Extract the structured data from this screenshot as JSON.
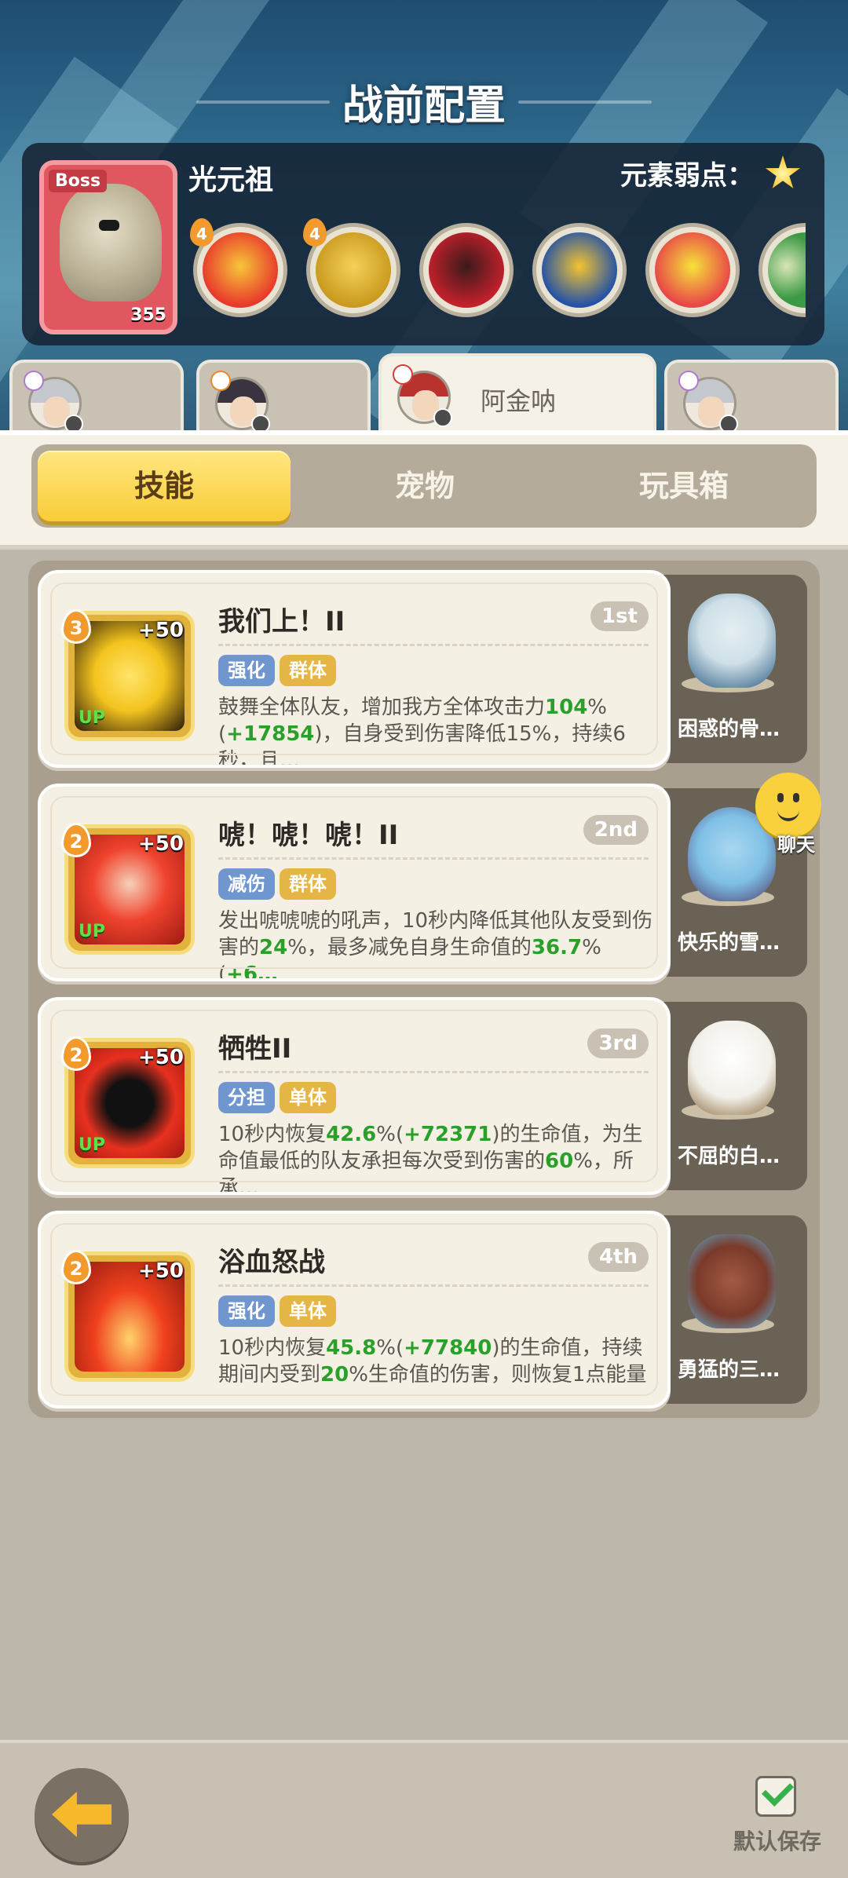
{
  "header": {
    "title": "战前配置"
  },
  "boss": {
    "badge": "Boss",
    "level": "355",
    "name": "光元祖",
    "weakness_label": "元素弱点：",
    "weakness_icon": "light-star-icon",
    "skills": [
      {
        "icon": "punch-fist-icon",
        "level": "4",
        "colors": [
          "#e8392b",
          "#f7c63a"
        ]
      },
      {
        "icon": "gold-burst-icon",
        "level": "4",
        "colors": [
          "#c99a1e",
          "#f5d15a"
        ]
      },
      {
        "icon": "red-dragon-icon",
        "level": "",
        "colors": [
          "#c3202c",
          "#3b1a1a"
        ]
      },
      {
        "icon": "yellow-bird-icon",
        "level": "",
        "colors": [
          "#2452a6",
          "#f4c430"
        ]
      },
      {
        "icon": "red-shoe-icon",
        "level": "",
        "colors": [
          "#e84747",
          "#f6e33a"
        ]
      },
      {
        "icon": "green-partial-icon",
        "level": "",
        "colors": [
          "#3d9a44",
          "#d8e6b8"
        ]
      }
    ]
  },
  "heroes": [
    {
      "name": "",
      "avatar": "silver-hair-hero-avatar",
      "hair": "#c4c7cc",
      "mini": "#b07ad0"
    },
    {
      "name": "",
      "avatar": "dark-hair-hero-avatar",
      "hair": "#3a3440",
      "mini": "#e28b2a"
    },
    {
      "name": "阿金呐",
      "avatar": "red-hair-hero-avatar",
      "hair": "#b8322e",
      "mini": "#d93a3a",
      "active": true
    },
    {
      "name": "",
      "avatar": "silver-hair-hero-avatar-2",
      "hair": "#c4c7cc",
      "mini": "#b07ad0"
    }
  ],
  "tabs": {
    "skills": "技能",
    "pets": "宠物",
    "toybox": "玩具箱",
    "active": "skills"
  },
  "skills": [
    {
      "level": "3",
      "plus": "+50",
      "up": "UP",
      "title": "我们上！II",
      "rank": "1st",
      "tags": [
        "强化",
        "群体"
      ],
      "desc_parts": [
        {
          "t": "鼓舞全体队友，增加我方全体攻击力"
        },
        {
          "t": "104",
          "g": true
        },
        {
          "t": "%("
        },
        {
          "t": "+17854",
          "g": true
        },
        {
          "t": ")，自身受到伤害降低15%，持续6秒，且…"
        }
      ],
      "icon": "cheering-crowd-icon",
      "icon_colors": [
        "#f4c41e",
        "#2a1a0a"
      ],
      "pet": {
        "name": "困惑的骨…",
        "icon": "confused-dragon-pet-icon",
        "colors": [
          "#cfe0e8",
          "#2f5f86"
        ]
      }
    },
    {
      "level": "2",
      "plus": "+50",
      "up": "UP",
      "title": "唬！唬！唬！II",
      "rank": "2nd",
      "tags": [
        "减伤",
        "群体"
      ],
      "desc_parts": [
        {
          "t": "发出唬唬唬的吼声，10秒内降低其他队友受到伤害的"
        },
        {
          "t": "24",
          "g": true
        },
        {
          "t": "%，最多减免自身生命值的"
        },
        {
          "t": "36.7",
          "g": true
        },
        {
          "t": "%("
        },
        {
          "t": "+6…",
          "g": true
        }
      ],
      "icon": "shouting-face-icon",
      "icon_colors": [
        "#f0432e",
        "#f6d0b8"
      ],
      "pet": {
        "name": "快乐的雪…",
        "icon": "happy-snow-pet-icon",
        "colors": [
          "#7fc0e6",
          "#4b3a6b"
        ]
      }
    },
    {
      "level": "2",
      "plus": "+50",
      "up": "UP",
      "title": "牺牲II",
      "rank": "3rd",
      "tags": [
        "分担",
        "单体"
      ],
      "desc_parts": [
        {
          "t": "10秒内恢复"
        },
        {
          "t": "42.6",
          "g": true
        },
        {
          "t": "%("
        },
        {
          "t": "+72371",
          "g": true
        },
        {
          "t": ")的生命值，为生命值最低的队友承担每次受到伤害的"
        },
        {
          "t": "60",
          "g": true
        },
        {
          "t": "%，所承…"
        }
      ],
      "icon": "sacrifice-silhouette-icon",
      "icon_colors": [
        "#e8311f",
        "#111111"
      ],
      "pet": {
        "name": "不屈的白…",
        "icon": "white-goat-pet-icon",
        "colors": [
          "#f2f0ea",
          "#8a6a3a"
        ]
      }
    },
    {
      "level": "2",
      "plus": "+50",
      "up": "",
      "title": "浴血怒战",
      "rank": "4th",
      "tags": [
        "强化",
        "单体"
      ],
      "desc_parts": [
        {
          "t": "10秒内恢复"
        },
        {
          "t": "45.8",
          "g": true
        },
        {
          "t": "%("
        },
        {
          "t": "+77840",
          "g": true
        },
        {
          "t": ")的生命值，持续期间内受到"
        },
        {
          "t": "20",
          "g": true
        },
        {
          "t": "%生命值的伤害，则恢复1点能量"
        }
      ],
      "icon": "blood-drops-icon",
      "icon_colors": [
        "#f0401e",
        "#ffd36b"
      ],
      "pet": {
        "name": "勇猛的三…",
        "icon": "brave-triceratops-pet-icon",
        "colors": [
          "#7a3a2a",
          "#5ab8e0"
        ]
      }
    }
  ],
  "chat": {
    "label": "聊天",
    "icon": "smiley-chat-icon"
  },
  "footer": {
    "save_label": "默认保存",
    "back_icon": "back-arrow-icon",
    "save_icon": "checkbox-checked-icon"
  }
}
